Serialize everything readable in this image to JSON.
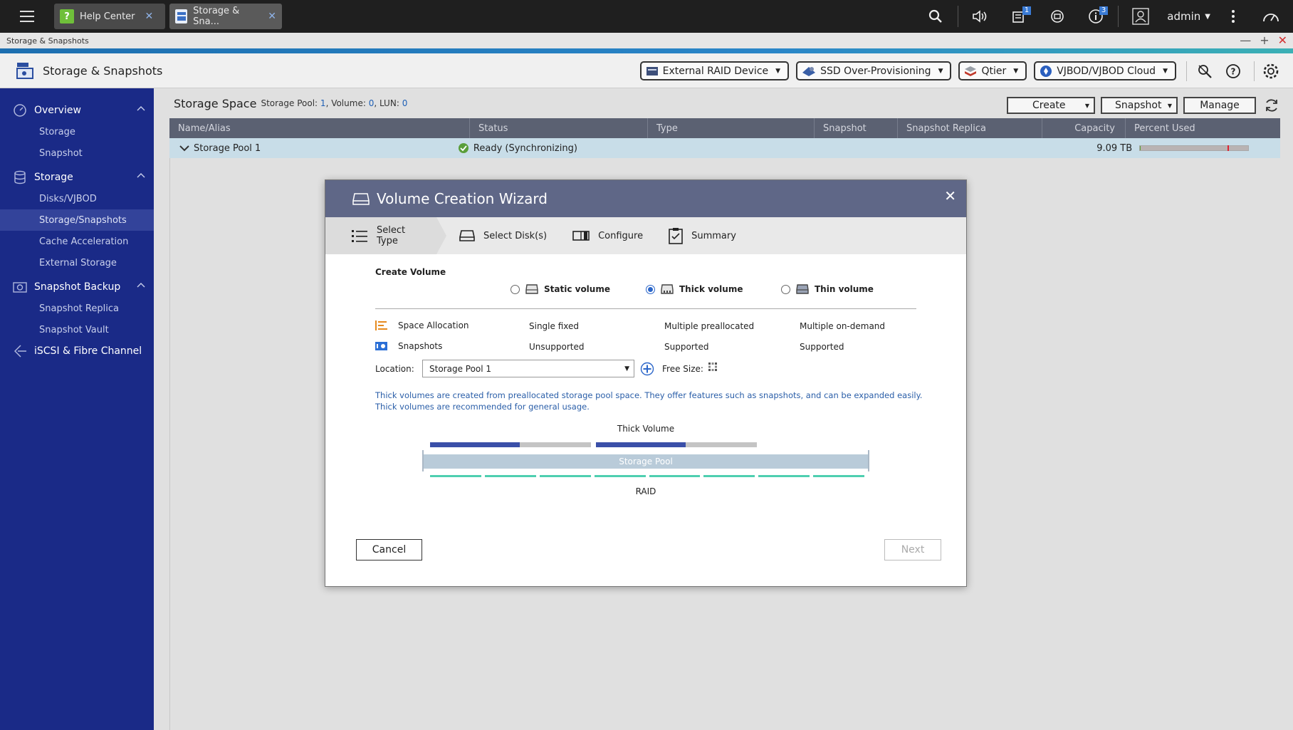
{
  "os_tabs": [
    {
      "label": "Help Center"
    },
    {
      "label": "Storage & Sna..."
    }
  ],
  "top_bar": {
    "user": "admin",
    "badges": {
      "tasks": "1",
      "notifications": "3"
    }
  },
  "window": {
    "title": "Storage & Snapshots"
  },
  "app_header": {
    "title": "Storage & Snapshots",
    "tools": [
      {
        "label": "External RAID Device"
      },
      {
        "label": "SSD Over-Provisioning"
      },
      {
        "label": "Qtier"
      },
      {
        "label": "VJBOD/VJBOD Cloud"
      }
    ]
  },
  "sidebar": {
    "groups": [
      {
        "label": "Overview",
        "items": [
          "Storage",
          "Snapshot"
        ]
      },
      {
        "label": "Storage",
        "items": [
          "Disks/VJBOD",
          "Storage/Snapshots",
          "Cache Acceleration",
          "External Storage"
        ]
      },
      {
        "label": "Snapshot Backup",
        "items": [
          "Snapshot Replica",
          "Snapshot Vault"
        ]
      },
      {
        "label": "iSCSI & Fibre Channel",
        "items": []
      }
    ],
    "active_item": "Storage/Snapshots"
  },
  "content": {
    "title": "Storage Space",
    "meta": {
      "pool_label": "Storage Pool:",
      "pool_count": "1",
      "volume_label": ", Volume:",
      "volume_count": "0",
      "lun_label": ", LUN:",
      "lun_count": "0"
    },
    "actions": {
      "create": "Create",
      "snapshot": "Snapshot",
      "manage": "Manage"
    },
    "columns": [
      "Name/Alias",
      "Status",
      "Type",
      "Snapshot",
      "Snapshot Replica",
      "Capacity",
      "Percent Used"
    ],
    "rows": [
      {
        "name": "Storage Pool 1",
        "status": "Ready (Synchronizing)",
        "capacity": "9.09 TB",
        "percent_used": 0.8
      }
    ]
  },
  "dialog": {
    "title": "Volume Creation Wizard",
    "steps": [
      "Select Type",
      "Select Disk(s)",
      "Configure",
      "Summary"
    ],
    "section_label": "Create Volume",
    "options": [
      {
        "label": "Static volume",
        "selected": false
      },
      {
        "label": "Thick volume",
        "selected": true
      },
      {
        "label": "Thin volume",
        "selected": false
      }
    ],
    "features": [
      {
        "label": "Space Allocation",
        "values": [
          "Single fixed",
          "Multiple preallocated",
          "Multiple on-demand"
        ]
      },
      {
        "label": "Snapshots",
        "values": [
          "Unsupported",
          "Supported",
          "Supported"
        ]
      }
    ],
    "location_label": "Location:",
    "location_value": "Storage Pool 1",
    "free_size_label": "Free Size:",
    "description": "Thick volumes are created from preallocated storage pool space. They offer features such as snapshots, and can be expanded easily. Thick volumes are recommended for general usage.",
    "diagram": {
      "top_label": "Thick Volume",
      "pool_label": "Storage Pool",
      "raid_label": "RAID"
    },
    "buttons": {
      "cancel": "Cancel",
      "next": "Next"
    }
  },
  "colors": {
    "sidebar": "#1a2a87",
    "accent": "#2a86c8",
    "dialog_header": "#5f6787",
    "link": "#2a5ea8"
  }
}
